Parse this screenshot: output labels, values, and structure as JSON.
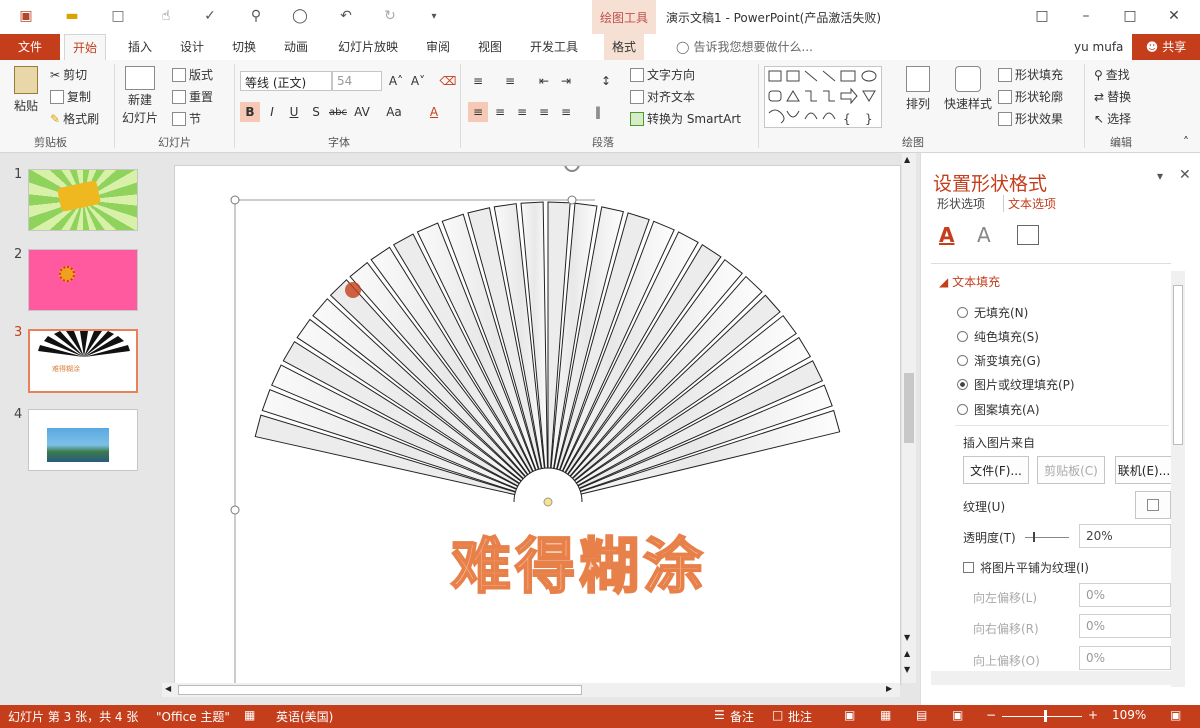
{
  "titlebar": {
    "context_tools": "绘图工具",
    "title": "演示文稿1 - PowerPoint(产品激活失败)"
  },
  "tabs": {
    "file": "文件",
    "items": [
      "开始",
      "插入",
      "设计",
      "切换",
      "动画",
      "幻灯片放映",
      "审阅",
      "视图",
      "开发工具",
      "格式"
    ],
    "tell_me": "告诉我您想要做什么...",
    "user": "yu mufa",
    "share": "共享"
  },
  "ribbon": {
    "clipboard": {
      "paste": "粘贴",
      "cut": "剪切",
      "copy": "复制",
      "format_painter": "格式刷",
      "label": "剪贴板"
    },
    "slides": {
      "new_slide_line1": "新建",
      "new_slide_line2": "幻灯片",
      "layout": "版式",
      "reset": "重置",
      "section": "节",
      "label": "幻灯片"
    },
    "font": {
      "font_name": "等线 (正文)",
      "font_size": "54",
      "label": "字体"
    },
    "paragraph": {
      "text_direction": "文字方向",
      "align_text": "对齐文本",
      "smartart": "转换为 SmartArt",
      "label": "段落"
    },
    "drawing": {
      "arrange": "排列",
      "quick_styles": "快速样式",
      "shape_fill": "形状填充",
      "shape_outline": "形状轮廓",
      "shape_effects": "形状效果",
      "label": "绘图"
    },
    "editing": {
      "find": "查找",
      "replace": "替换",
      "select": "选择",
      "label": "编辑"
    }
  },
  "slides": [
    {
      "num": "1",
      "bg": "#7cc84e"
    },
    {
      "num": "2",
      "bg": "#ff5aa0"
    },
    {
      "num": "3",
      "bg": "#ffffff",
      "active": true
    },
    {
      "num": "4",
      "bg": "#ffffff"
    }
  ],
  "slide_content": {
    "title": "难得糊涂"
  },
  "format_pane": {
    "title": "设置形状格式",
    "tab_shape": "形状选项",
    "tab_text": "文本选项",
    "section": "文本填充",
    "options": [
      "无填充(N)",
      "纯色填充(S)",
      "渐变填充(G)",
      "图片或纹理填充(P)",
      "图案填充(A)"
    ],
    "selected_option": "图片或纹理填充(P)",
    "insert_from": "插入图片来自",
    "btn_file": "文件(F)...",
    "btn_clipboard": "剪贴板(C)",
    "btn_online": "联机(E)...",
    "texture": "纹理(U)",
    "transparency": "透明度(T)",
    "transparency_value": "20%",
    "tile": "将图片平铺为纹理(I)",
    "offset_left": "向左偏移(L)",
    "offset_left_value": "0%",
    "offset_right": "向右偏移(R)",
    "offset_right_value": "0%",
    "offset_top": "向上偏移(O)",
    "offset_top_value": "0%"
  },
  "status": {
    "slide_info": "幻灯片 第 3 张，共 4 张",
    "theme": "\"Office 主题\"",
    "language": "英语(美国)",
    "notes": "备注",
    "comments": "批注",
    "zoom": "109%"
  },
  "colors": {
    "accent": "#c43e1c",
    "title_text": "#f4a27a"
  }
}
